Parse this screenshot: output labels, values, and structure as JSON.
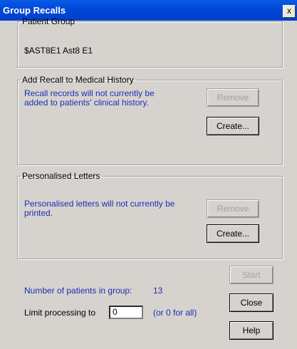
{
  "window": {
    "title": "Group Recalls",
    "close_symbol": "x"
  },
  "patient_group": {
    "legend": "Patient Group",
    "value": "$AST8E1   Ast8 E1"
  },
  "recall": {
    "legend": "Add Recall to Medical History",
    "message_line1": "Recall records will not currently be",
    "message_line2": "added to patients' clinical history.",
    "remove_label": "Remove",
    "create_label": "Create..."
  },
  "letters": {
    "legend": "Personalised Letters",
    "message_line1": "Personalised letters will not currently be",
    "message_line2": "printed.",
    "remove_label": "Remove",
    "create_label": "Create..."
  },
  "footer": {
    "patients_label": "Number of patients in group:",
    "patients_count": "13",
    "limit_label": "Limit processing to",
    "limit_value": "0",
    "limit_hint": "(or 0 for all)",
    "start_label": "Start",
    "close_label": "Close",
    "help_label": "Help"
  }
}
